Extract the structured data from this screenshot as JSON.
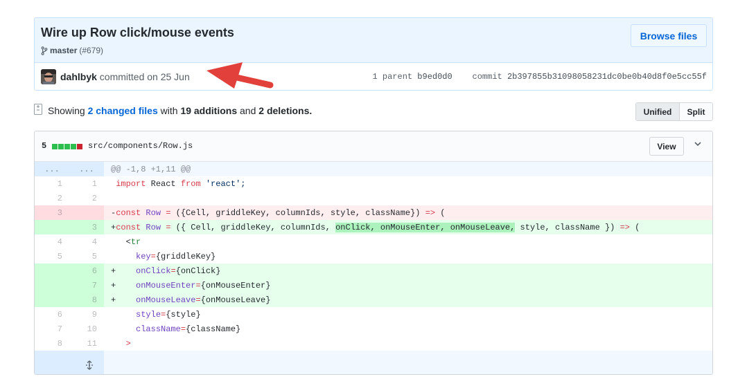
{
  "commit": {
    "title": "Wire up Row click/mouse events",
    "branch": "master",
    "pr_ref": "(#679)",
    "browse_label": "Browse files",
    "author": "dahlbyk",
    "committed_text": "committed on 25 Jun",
    "parent_label": "1 parent",
    "parent_sha": "b9ed0d0",
    "commit_label": "commit",
    "commit_sha": "2b397855b31098058231dc0be0b40d8f0e5cc55f"
  },
  "toc": {
    "showing": "Showing",
    "changed_files": "2 changed files",
    "with": "with",
    "additions": "19 additions",
    "and": "and",
    "deletions": "2 deletions.",
    "unified_label": "Unified",
    "split_label": "Split"
  },
  "file": {
    "change_count": "5",
    "path": "src/components/Row.js",
    "view_label": "View",
    "diffstat": [
      "add",
      "add",
      "add",
      "add",
      "del"
    ]
  },
  "diff": {
    "hunk_left": "...",
    "hunk_right": "...",
    "hunk_header": "@@ -1,8 +1,11 @@",
    "lines": [
      {
        "type": "ctx",
        "old": "1",
        "new": "1"
      },
      {
        "type": "ctx",
        "old": "2",
        "new": "2"
      },
      {
        "type": "del",
        "old": "3",
        "new": ""
      },
      {
        "type": "add",
        "old": "",
        "new": "3"
      },
      {
        "type": "ctx",
        "old": "4",
        "new": "4"
      },
      {
        "type": "ctx",
        "old": "5",
        "new": "5"
      },
      {
        "type": "add",
        "old": "",
        "new": "6"
      },
      {
        "type": "add",
        "old": "",
        "new": "7"
      },
      {
        "type": "add",
        "old": "",
        "new": "8"
      },
      {
        "type": "ctx",
        "old": "6",
        "new": "9"
      },
      {
        "type": "ctx",
        "old": "7",
        "new": "10"
      },
      {
        "type": "ctx",
        "old": "8",
        "new": "11"
      }
    ],
    "code": {
      "l1_import": "import",
      "l1_react": " React ",
      "l1_from": "from",
      "l1_str": " 'react';",
      "l3_kw": "const",
      "l3_name": "Row",
      "l3_eq": " = ",
      "l3_args": "({Cell, griddleKey, columnIds, style, className}) ",
      "l3_arrow": "=>",
      "l3_end": " (",
      "l4_kw": "const",
      "l4_name": "Row",
      "l4_eq": " = ",
      "l4_a": "({ ",
      "l4_b": "Cell, griddleKey, columnIds, ",
      "l4_hl": "onClick, onMouseEnter, onMouseLeave,",
      "l4_c": " style, className ",
      "l4_d": "}) ",
      "l4_arrow": "=>",
      "l4_end": " (",
      "l5_open": "<",
      "l5_tag": "tr",
      "l6_attr": "key",
      "l6_eq": "=",
      "l6_val": "{griddleKey}",
      "l7_attr": "onClick",
      "l7_eq": "=",
      "l7_val": "{onClick}",
      "l8_attr": "onMouseEnter",
      "l8_eq": "=",
      "l8_val": "{onMouseEnter}",
      "l9_attr": "onMouseLeave",
      "l9_eq": "=",
      "l9_val": "{onMouseLeave}",
      "l10_attr": "style",
      "l10_eq": "=",
      "l10_val": "{style}",
      "l11_attr": "className",
      "l11_eq": "=",
      "l11_val": "{className}",
      "l12_close": ">"
    }
  },
  "colors": {
    "link": "#0366d6",
    "add_bg": "#e6ffed",
    "del_bg": "#ffeef0",
    "annotation_arrow": "#e2403a"
  }
}
